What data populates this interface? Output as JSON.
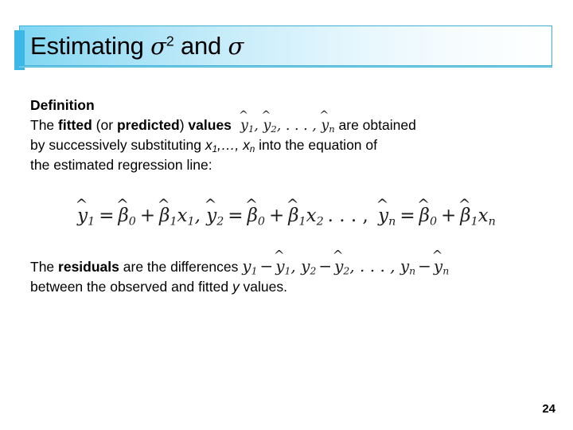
{
  "slide": {
    "title": {
      "prefix": "Estimating ",
      "symbol_1": "σ",
      "symbol_1_sup": "2",
      "middle": " and ",
      "symbol_2": "σ"
    },
    "page_number": "24",
    "colors": {
      "accent_bar": "#3BB8E8",
      "title_border": "#3FAFD4",
      "title_gradient_start": "#7FD6F2",
      "title_gradient_end": "#FFFFFF",
      "background": "#FFFFFF",
      "text": "#000000"
    }
  },
  "definition": {
    "heading": "Definition",
    "line2": {
      "t1": "The ",
      "b1": "fitted",
      "t2": " (or ",
      "b2": "predicted",
      "t3": ") ",
      "b3": "values",
      "math": "ŷ₁, ŷ₂, . . . , ŷₙ",
      "t4": " are obtained"
    },
    "line3": {
      "t1": "by successively substituting ",
      "math": "x₁,…, xₙ",
      "t2": " into the equation of"
    },
    "line4": "the estimated regression line:"
  },
  "equation": {
    "text": "ŷ₁ = β̂0 + β̂1x₁, ŷ₂ = β̂0 + β̂1x₂, . . . , ŷₙ = β̂0 + β̂1xₙ",
    "terms": [
      {
        "lhs": "ŷ",
        "lhs_sub": "1",
        "rel": "=",
        "a": "β̂",
        "a_sub": "0",
        "op": "+",
        "b": "β̂",
        "b_sub": "1",
        "x": "x",
        "x_sub": "1"
      },
      {
        "lhs": "ŷ",
        "lhs_sub": "2",
        "rel": "=",
        "a": "β̂",
        "a_sub": "0",
        "op": "+",
        "b": "β̂",
        "b_sub": "1",
        "x": "x",
        "x_sub": "2"
      },
      {
        "lhs": "ŷ",
        "lhs_sub": "n",
        "rel": "=",
        "a": "β̂",
        "a_sub": "0",
        "op": "+",
        "b": "β̂",
        "b_sub": "1",
        "x": "x",
        "x_sub": "n"
      }
    ],
    "ellipsis": ". . . ,"
  },
  "residuals": {
    "t1": "The ",
    "b1": "residuals",
    "t2": " are the differences ",
    "math": "y₁ − ŷ₁, y₂ − ŷ₂, . . . , yₙ − ŷₙ",
    "line2_t1": "between the observed and fitted ",
    "line2_italic": "y",
    "line2_t2": " values."
  }
}
